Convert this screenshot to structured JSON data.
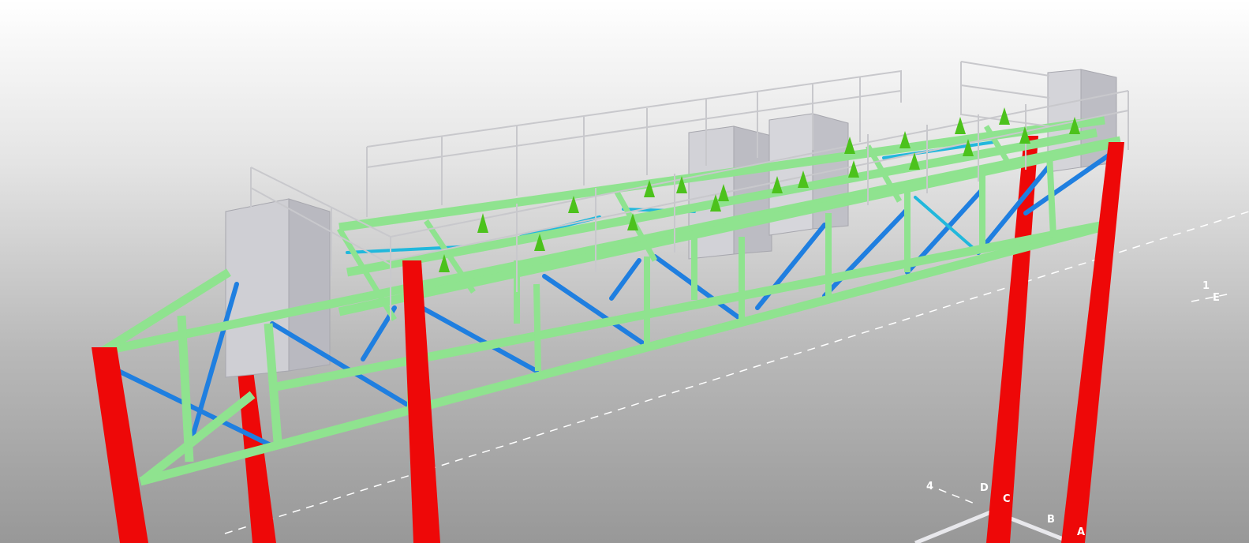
{
  "viewport": {
    "type": "3d-structural-model-view",
    "background": {
      "top": "#ffffff",
      "bottom": "#989898"
    }
  },
  "colors": {
    "column": "#ee0808",
    "beam": "#8fe38f",
    "beam_edge": "#5fc25f",
    "brace": "#1f7fe0",
    "brace_light": "#21b8dc",
    "equipment": "#cfcfd4",
    "handrail": "#c8c8cc",
    "load_marker": "#4cc21c",
    "grid_line": "#ffffff"
  },
  "grid_labels": {
    "row_1": "1",
    "row_4": "4",
    "col_a": "A",
    "col_b": "B",
    "col_c": "C",
    "col_d": "D",
    "col_e": "E"
  }
}
